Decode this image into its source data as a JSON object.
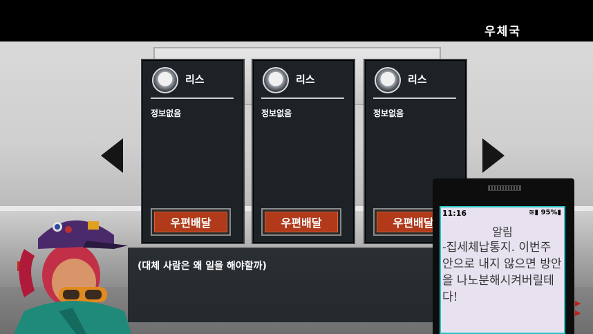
{
  "header": {
    "location": "우체국"
  },
  "cards": [
    {
      "name": "리스",
      "info": "정보없음",
      "button": "우편배달"
    },
    {
      "name": "리스",
      "info": "정보없음",
      "button": "우편배달"
    },
    {
      "name": "리스",
      "info": "정보없음",
      "button": "우편배달"
    }
  ],
  "dialog": {
    "text": "(대체 사람은 왜 일을 해야할까)"
  },
  "phone": {
    "time": "11:16",
    "battery": "95%",
    "title": "알림",
    "message": "-집세체납통지. 이번주 안으로 내지 않으면 방안을 나노분해시켜버릴테다!"
  },
  "colors": {
    "button_fill": "#b03a1a",
    "card_bg": "#1d2227",
    "screen_border": "#2ac2c2",
    "screen_bg": "#e8e2f0"
  }
}
